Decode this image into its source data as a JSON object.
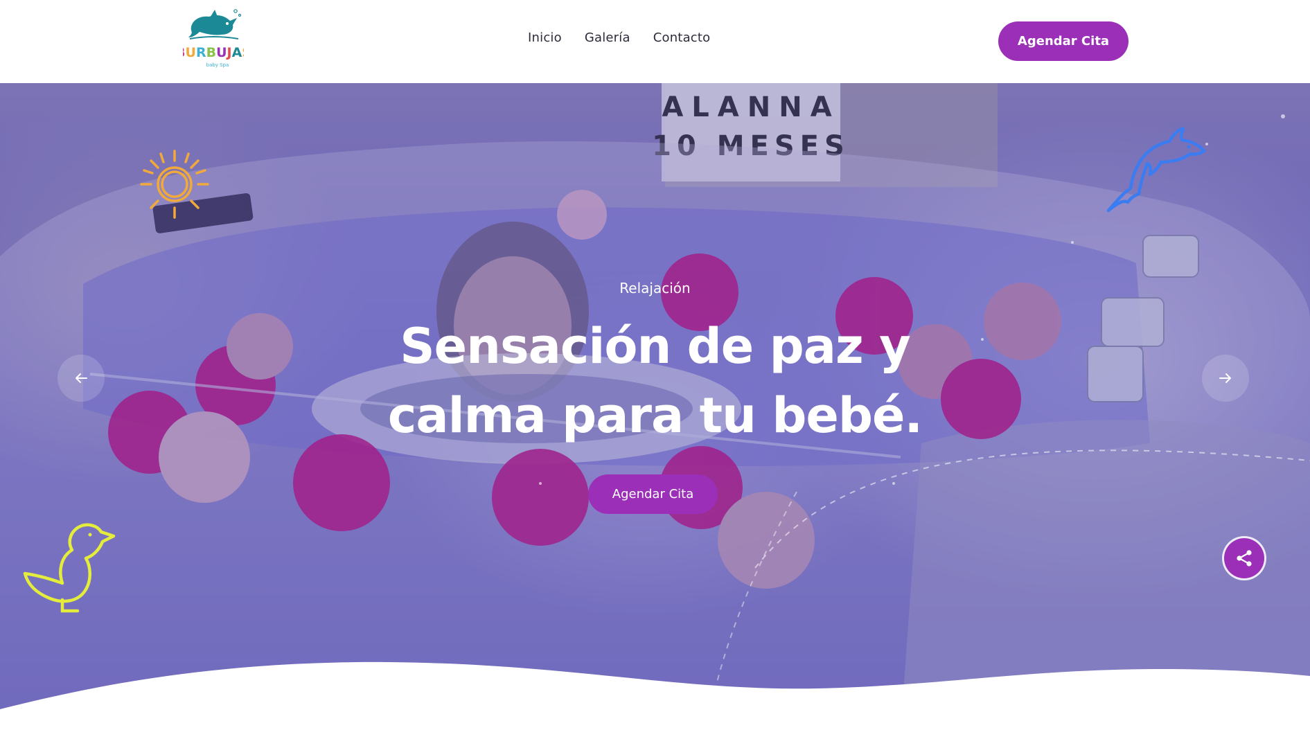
{
  "brand": {
    "logo_text": "BURBUJAS",
    "logo_subtext": "baby Spa"
  },
  "nav": {
    "items": [
      {
        "label": "Inicio"
      },
      {
        "label": "Galería"
      },
      {
        "label": "Contacto"
      }
    ]
  },
  "header": {
    "cta_label": "Agendar Cita"
  },
  "hero": {
    "eyebrow": "Relajación",
    "headline_line1": "Sensación de paz y",
    "headline_line2": "calma para tu bebé.",
    "cta_label": "Agendar Cita",
    "sign_line1": "ALANNA",
    "sign_line2": "10 MESES"
  },
  "icons": {
    "prev": "arrow-left-icon",
    "next": "arrow-right-icon",
    "share": "share-icon",
    "sun": "sun-icon",
    "dolphin": "dolphin-icon",
    "duck": "duck-icon"
  },
  "colors": {
    "accent": "#9b2fb8",
    "sun": "#f2a93b",
    "dolphin": "#3b7cf0",
    "duck": "#e4ec3c",
    "hero_tint": "#5a54b8"
  }
}
